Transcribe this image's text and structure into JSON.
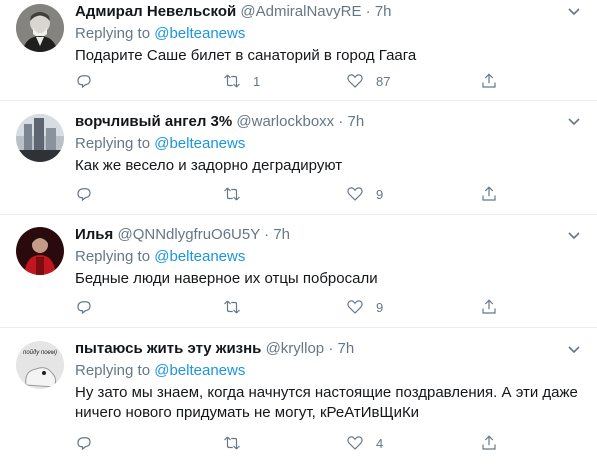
{
  "tweets": [
    {
      "name": "Адмирал Невельской",
      "handle": "@AdmiralNavyRE",
      "dot": "·",
      "time": "7h",
      "replying_label": "Replying to",
      "replying_to": "@belteanews",
      "text": "Подарите Саше билет в санаторий в город Гаага",
      "replies": "",
      "retweets": "1",
      "likes": "87"
    },
    {
      "name": "ворчливый ангел 3%",
      "handle": "@warlockboxx",
      "dot": "·",
      "time": "7h",
      "replying_label": "Replying to",
      "replying_to": "@belteanews",
      "text": "Как же весело и задорно деградируют",
      "replies": "",
      "retweets": "",
      "likes": "9"
    },
    {
      "name": "Илья",
      "handle": "@QNNdlygfruO6U5Y",
      "dot": "·",
      "time": "7h",
      "replying_label": "Replying to",
      "replying_to": "@belteanews",
      "text": "Бедные люди наверное их отцы побросали",
      "replies": "",
      "retweets": "",
      "likes": "9"
    },
    {
      "name": "пытаюсь жить эту жизнь",
      "handle": "@kryllop",
      "dot": "·",
      "time": "7h",
      "replying_label": "Replying to",
      "replying_to": "@belteanews",
      "text": "Ну зато мы знаем, когда начнутся настоящие поздравления. А эти даже ничего нового придумать не могут, кРеАтИвЩиКи",
      "replies": "",
      "retweets": "",
      "likes": "4",
      "avatar_text": "пойду поем)"
    }
  ],
  "icons": {
    "reply": "reply-icon",
    "retweet": "retweet-icon",
    "like": "heart-icon",
    "share": "share-icon",
    "menu": "chevron-down-icon"
  },
  "colors": {
    "text": "#14171a",
    "secondary": "#657786",
    "link": "#1b95e0",
    "divider": "#e6ecf0"
  }
}
